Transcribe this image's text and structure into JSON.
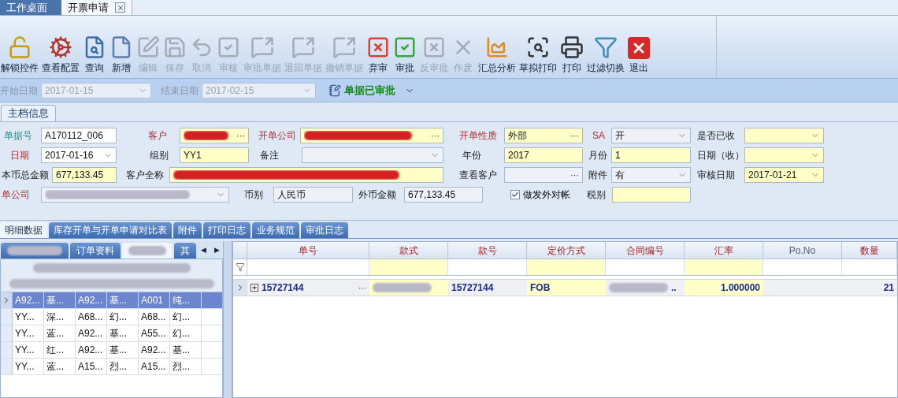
{
  "doc_tabs": [
    {
      "label": "工作桌面",
      "selected": false,
      "closable": false
    },
    {
      "label": "开票申请",
      "selected": true,
      "closable": true
    }
  ],
  "toolbar": [
    {
      "kind": "unlock",
      "label": "解锁控件",
      "disabled": false
    },
    {
      "kind": "config",
      "label": "查看配置",
      "disabled": false
    },
    {
      "kind": "query",
      "label": "查询",
      "disabled": false
    },
    {
      "kind": "new",
      "label": "新增",
      "disabled": false
    },
    {
      "kind": "edit",
      "label": "编辑",
      "disabled": true
    },
    {
      "kind": "save",
      "label": "保存",
      "disabled": true
    },
    {
      "kind": "undo",
      "label": "取消",
      "disabled": true
    },
    {
      "kind": "check",
      "label": "审核",
      "disabled": true
    },
    {
      "kind": "forward",
      "label": "审批单据",
      "disabled": true
    },
    {
      "kind": "forward",
      "label": "退回单据",
      "disabled": true
    },
    {
      "kind": "forward",
      "label": "撤销单据",
      "disabled": true
    },
    {
      "kind": "reject",
      "label": "弃审",
      "disabled": false
    },
    {
      "kind": "approve",
      "label": "审批",
      "disabled": false
    },
    {
      "kind": "reject",
      "label": "反审批",
      "disabled": true
    },
    {
      "kind": "cross",
      "label": "作废",
      "disabled": true
    },
    {
      "kind": "chart",
      "label": "汇总分析",
      "disabled": false
    },
    {
      "kind": "preview",
      "label": "草拟打印",
      "disabled": false
    },
    {
      "kind": "print",
      "label": "打印",
      "disabled": false
    },
    {
      "kind": "filter",
      "label": "过滤切换",
      "disabled": false
    },
    {
      "kind": "exit",
      "label": "退出",
      "disabled": false
    }
  ],
  "filter_bar": {
    "start_label": "开始日期",
    "start_value": "2017-01-15",
    "end_label": "结束日期",
    "end_value": "2017-02-15",
    "status": "单据已审批",
    "disabled": true
  },
  "section_tab": {
    "label": "主档信息",
    "selected": true
  },
  "form_rows": [
    [
      {
        "kind": "label",
        "text": "单据号",
        "required": false,
        "key": true
      },
      {
        "kind": "text_field",
        "value": "A170112_006",
        "highlighted": false,
        "redacted": false
      },
      {
        "kind": "label",
        "text": "客户",
        "required": true,
        "key": false
      },
      {
        "kind": "lookup_field",
        "button": "···",
        "highlighted": true,
        "redacted": true
      },
      {
        "kind": "label",
        "text": "开单公司",
        "required": true,
        "key": false
      },
      {
        "kind": "lookup_field",
        "button": "···",
        "highlighted": true,
        "redacted": true
      },
      {
        "kind": "label",
        "text": "开单性质",
        "required": true,
        "key": false
      },
      {
        "kind": "lookup_field",
        "value": "外部",
        "button": "···",
        "highlighted": true,
        "redacted": false
      },
      {
        "kind": "label",
        "text": "SA",
        "required": true,
        "key": false
      },
      {
        "kind": "dropdown_field",
        "value": "开",
        "highlighted": false,
        "redacted": false
      },
      {
        "kind": "label",
        "text": "是否已收",
        "required": false,
        "key": false
      },
      {
        "kind": "dropdown_field",
        "highlighted": true,
        "redacted": false
      }
    ],
    [
      {
        "kind": "label",
        "text": "日期",
        "required": true,
        "key": false
      },
      {
        "kind": "dropdown_field",
        "value": "2017-01-16",
        "highlighted": false,
        "redacted": false
      },
      {
        "kind": "label",
        "text": "组别",
        "required": false,
        "key": false
      },
      {
        "kind": "text_field",
        "value": "YY1",
        "highlighted": true,
        "redacted": false
      },
      {
        "kind": "label",
        "text": "备注",
        "required": false,
        "key": false
      },
      {
        "kind": "dropdown_field",
        "highlighted": false,
        "redacted": false
      },
      {
        "kind": "label",
        "text": "年份",
        "required": false,
        "key": false
      },
      {
        "kind": "text_field",
        "value": "2017",
        "highlighted": true,
        "redacted": false
      },
      {
        "kind": "label",
        "text": "月份",
        "required": false,
        "key": false
      },
      {
        "kind": "text_field",
        "value": "1",
        "highlighted": true,
        "redacted": false
      },
      {
        "kind": "label",
        "text": "日期（收）",
        "required": false,
        "key": false
      },
      {
        "kind": "dropdown_field",
        "highlighted": true,
        "redacted": false
      }
    ],
    [
      {
        "kind": "label",
        "text": "本币总金额",
        "required": false,
        "key": false
      },
      {
        "kind": "text_field",
        "value": "677,133.45",
        "highlighted": true,
        "redacted": false
      },
      {
        "kind": "label",
        "text": "客户全称",
        "required": false,
        "key": false
      },
      {
        "kind": "text_field",
        "highlighted": true,
        "redacted": true
      },
      {
        "kind": "label",
        "text": "查看客户",
        "required": false,
        "key": false
      },
      {
        "kind": "lookup_field",
        "button": "···",
        "highlighted": false,
        "redacted": false
      },
      {
        "kind": "label",
        "text": "附件",
        "required": false,
        "key": false
      },
      {
        "kind": "dropdown_field",
        "value": "有",
        "highlighted": false,
        "redacted": false
      },
      {
        "kind": "label",
        "text": "审核日期",
        "required": false,
        "key": false
      },
      {
        "kind": "dropdown_field",
        "value": "2017-01-21",
        "highlighted": true,
        "redacted": false
      }
    ],
    [
      {
        "kind": "label",
        "text": "单公司",
        "required": true,
        "key": false
      },
      {
        "kind": "dropdown_field",
        "highlighted": false,
        "redacted": true
      },
      {
        "kind": "label",
        "text": "币别",
        "required": false,
        "key": false
      },
      {
        "kind": "text_field",
        "value": "人民币",
        "highlighted": false,
        "redacted": false
      },
      {
        "kind": "label",
        "text": "外币金额",
        "required": false,
        "key": false
      },
      {
        "kind": "text_field",
        "value": "677,133.45",
        "highlighted": false,
        "redacted": false
      },
      {
        "kind": "checkbox",
        "text": "做发外对帐",
        "checked": true
      },
      {
        "kind": "label",
        "text": "税别",
        "required": false,
        "key": false
      },
      {
        "kind": "text_field",
        "highlighted": true,
        "redacted": false
      }
    ]
  ],
  "detail_tabs": [
    {
      "label": "明细数据",
      "selected": true
    },
    {
      "label": "库存开单与开单申请对比表",
      "selected": false
    },
    {
      "label": "附件",
      "selected": false
    },
    {
      "label": "打印日志",
      "selected": false
    },
    {
      "label": "业务规范",
      "selected": false
    },
    {
      "label": "审批日志",
      "selected": false
    }
  ],
  "left_panel": {
    "tabs": [
      {
        "redacted": true,
        "selected": false
      },
      {
        "label": "订单资料",
        "redacted": false,
        "selected": false
      },
      {
        "redacted": true,
        "selected": true
      },
      {
        "label": "其",
        "redacted": false,
        "selected": false
      }
    ],
    "scroll_left": "◀",
    "scroll_right": "▶",
    "rows": [
      {
        "selected": true,
        "cells": [
          "A92...",
          "基...",
          "A92...",
          "基...",
          "A001",
          "纯..."
        ]
      },
      {
        "selected": false,
        "cells": [
          "YY...",
          "深...",
          "A68...",
          "幻...",
          "A68...",
          "幻..."
        ]
      },
      {
        "selected": false,
        "cells": [
          "YY...",
          "蓝...",
          "A92...",
          "基...",
          "A55...",
          "幻..."
        ]
      },
      {
        "selected": false,
        "cells": [
          "YY...",
          "红...",
          "A92...",
          "基...",
          "A92...",
          "基..."
        ]
      },
      {
        "selected": false,
        "cells": [
          "YY...",
          "蓝...",
          "A15...",
          "烈...",
          "A15...",
          "烈..."
        ]
      }
    ]
  },
  "detail_grid": {
    "columns": [
      {
        "label": "单号",
        "highlighted": false,
        "kind": "key"
      },
      {
        "label": "款式",
        "highlighted": true,
        "kind": "key"
      },
      {
        "label": "款号",
        "highlighted": false,
        "kind": "key"
      },
      {
        "label": "定价方式",
        "highlighted": true,
        "kind": "key"
      },
      {
        "label": "合同编号",
        "highlighted": false,
        "kind": "key"
      },
      {
        "label": "汇率",
        "highlighted": true,
        "kind": "key"
      },
      {
        "label": "Po.No",
        "highlighted": false,
        "kind": "plain"
      },
      {
        "label": "数量",
        "highlighted": false,
        "kind": "key"
      }
    ],
    "rows": [
      {
        "selected": true,
        "expanded": false,
        "cells": [
          {
            "kind": "text",
            "value": "15727144",
            "button": "···"
          },
          {
            "kind": "blurred"
          },
          {
            "kind": "text",
            "value": "15727144"
          },
          {
            "kind": "text",
            "value": "FOB"
          },
          {
            "kind": "blurred",
            "value": ".."
          },
          {
            "kind": "number",
            "value": "1.000000"
          },
          {
            "kind": "empty"
          },
          {
            "kind": "number",
            "value": "21"
          }
        ]
      }
    ]
  }
}
